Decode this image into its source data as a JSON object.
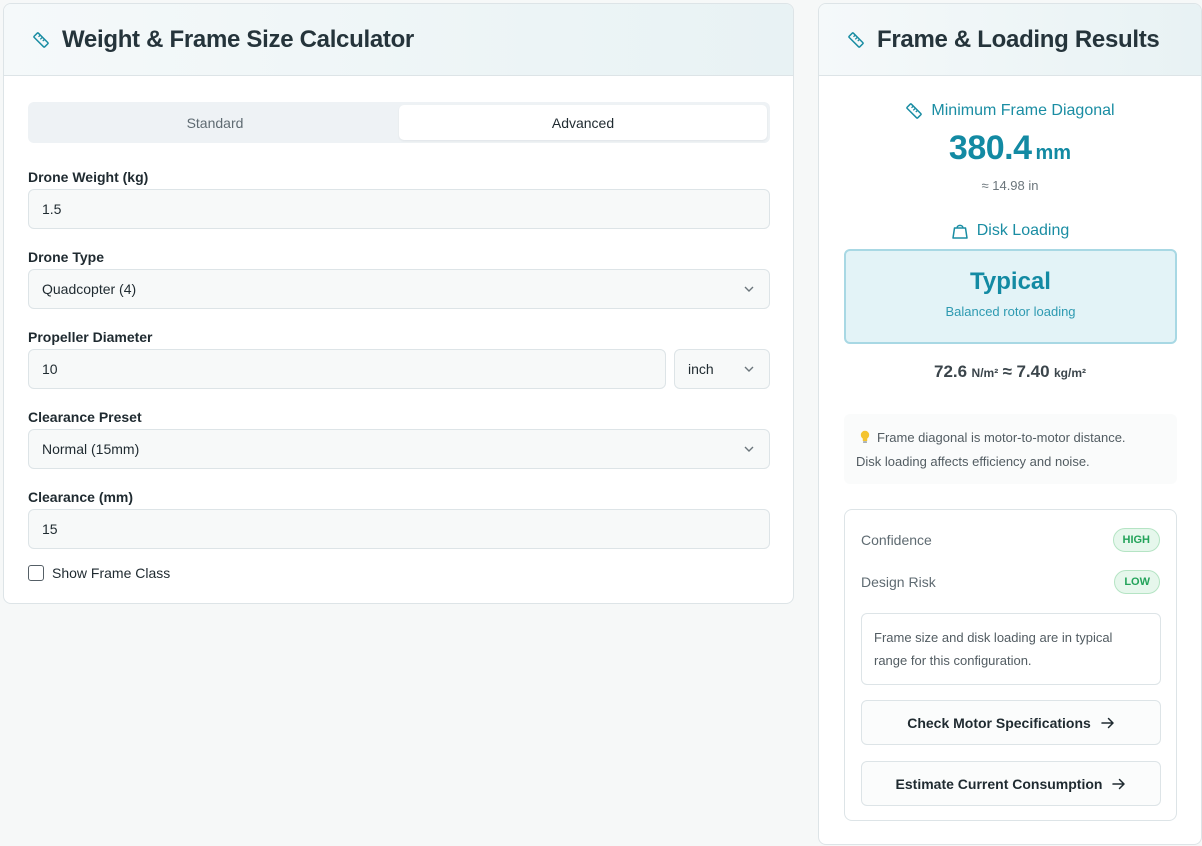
{
  "calculator": {
    "title": "Weight & Frame Size Calculator",
    "tabs": [
      {
        "label": "Standard",
        "active": false
      },
      {
        "label": "Advanced",
        "active": true
      }
    ],
    "fields": {
      "weight": {
        "label": "Drone Weight (kg)",
        "value": "1.5"
      },
      "type": {
        "label": "Drone Type",
        "value": "Quadcopter (4)"
      },
      "propeller": {
        "label": "Propeller Diameter",
        "value": "10",
        "unit": "inch"
      },
      "clearance_preset": {
        "label": "Clearance Preset",
        "value": "Normal (15mm)"
      },
      "clearance": {
        "label": "Clearance (mm)",
        "value": "15"
      }
    },
    "show_frame_class": {
      "label": "Show Frame Class",
      "checked": false
    }
  },
  "results": {
    "title": "Frame & Loading Results",
    "frame": {
      "label": "Minimum Frame Diagonal",
      "value": "380.4",
      "unit": "mm",
      "approx": "≈ 14.98 in"
    },
    "disk_loading": {
      "label": "Disk Loading",
      "class": "Typical",
      "desc": "Balanced rotor loading",
      "value_n": "72.6",
      "unit_n": "N/m²",
      "approx_sep": "≈",
      "value_kg": "7.40",
      "unit_kg": "kg/m²"
    },
    "tip": {
      "line1": "Frame diagonal is motor-to-motor distance.",
      "line2": "Disk loading affects efficiency and noise."
    },
    "assessment": {
      "confidence_label": "Confidence",
      "confidence_value": "HIGH",
      "risk_label": "Design Risk",
      "risk_value": "LOW",
      "note": "Frame size and disk loading are in typical range for this configuration."
    },
    "actions": [
      {
        "label": "Check Motor Specifications"
      },
      {
        "label": "Estimate Current Consumption"
      }
    ]
  },
  "colors": {
    "accent": "#138aa3",
    "badge_green": "#23a35a"
  }
}
